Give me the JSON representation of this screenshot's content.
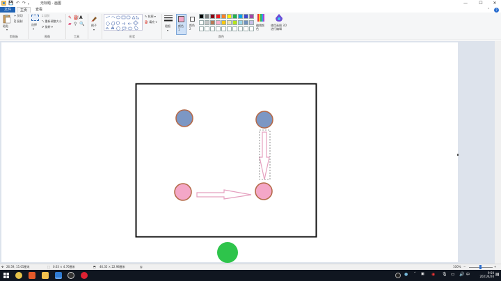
{
  "window": {
    "title": "无标题 - 画图",
    "minimize": "—",
    "maximize": "☐",
    "close": "✕"
  },
  "quick_access": [
    "💾",
    "↶",
    "↷"
  ],
  "menu": {
    "file": "文件",
    "home": "主页",
    "view": "查看"
  },
  "ribbon": {
    "clipboard": {
      "label": "剪贴板",
      "paste": "粘贴",
      "cut": "剪切",
      "copy": "复制"
    },
    "image": {
      "label": "图像",
      "select": "选择",
      "crop": "裁剪",
      "resize": "重新调整大小",
      "rotate": "旋转"
    },
    "tools": {
      "label": "工具"
    },
    "brushes": {
      "label": "刷子"
    },
    "shapes": {
      "label": "形状",
      "outline": "轮廓",
      "fill": "填充"
    },
    "size": {
      "label": "粗细"
    },
    "colors": {
      "label": "颜色",
      "color1": "颜色 1",
      "color2": "颜色 2",
      "edit_colors": "编辑颜色",
      "paint3d": "使用画图 3D 进行编辑"
    },
    "palette_row1": [
      "#000000",
      "#7f7f7f",
      "#880015",
      "#ed1c24",
      "#ff7f27",
      "#fff200",
      "#22b14c",
      "#00a2e8",
      "#3f48cc",
      "#a349a4"
    ],
    "palette_row2": [
      "#ffffff",
      "#c3c3c3",
      "#b97a57",
      "#ffaec9",
      "#ffc90e",
      "#efe4b0",
      "#b5e61d",
      "#99d9ea",
      "#7092be",
      "#c8bfe7"
    ],
    "color1_value": "#f4a7c7",
    "color2_value": "#ffffff"
  },
  "status": {
    "cursor": "26.59, 15.05厘米",
    "selection": "0.63 × 4.76厘米",
    "image_size": "46.35 × 22.98厘米",
    "zoom": "100%"
  },
  "clock": {
    "time": "9:50",
    "date": "2021/4/20"
  },
  "colors": {
    "blue_circle": "#7c97c4",
    "circle_border": "#b56b4a",
    "pink_circle": "#f4a7c7",
    "green_circle": "#2ec44b",
    "arrow_stroke": "#e5a0bf"
  }
}
